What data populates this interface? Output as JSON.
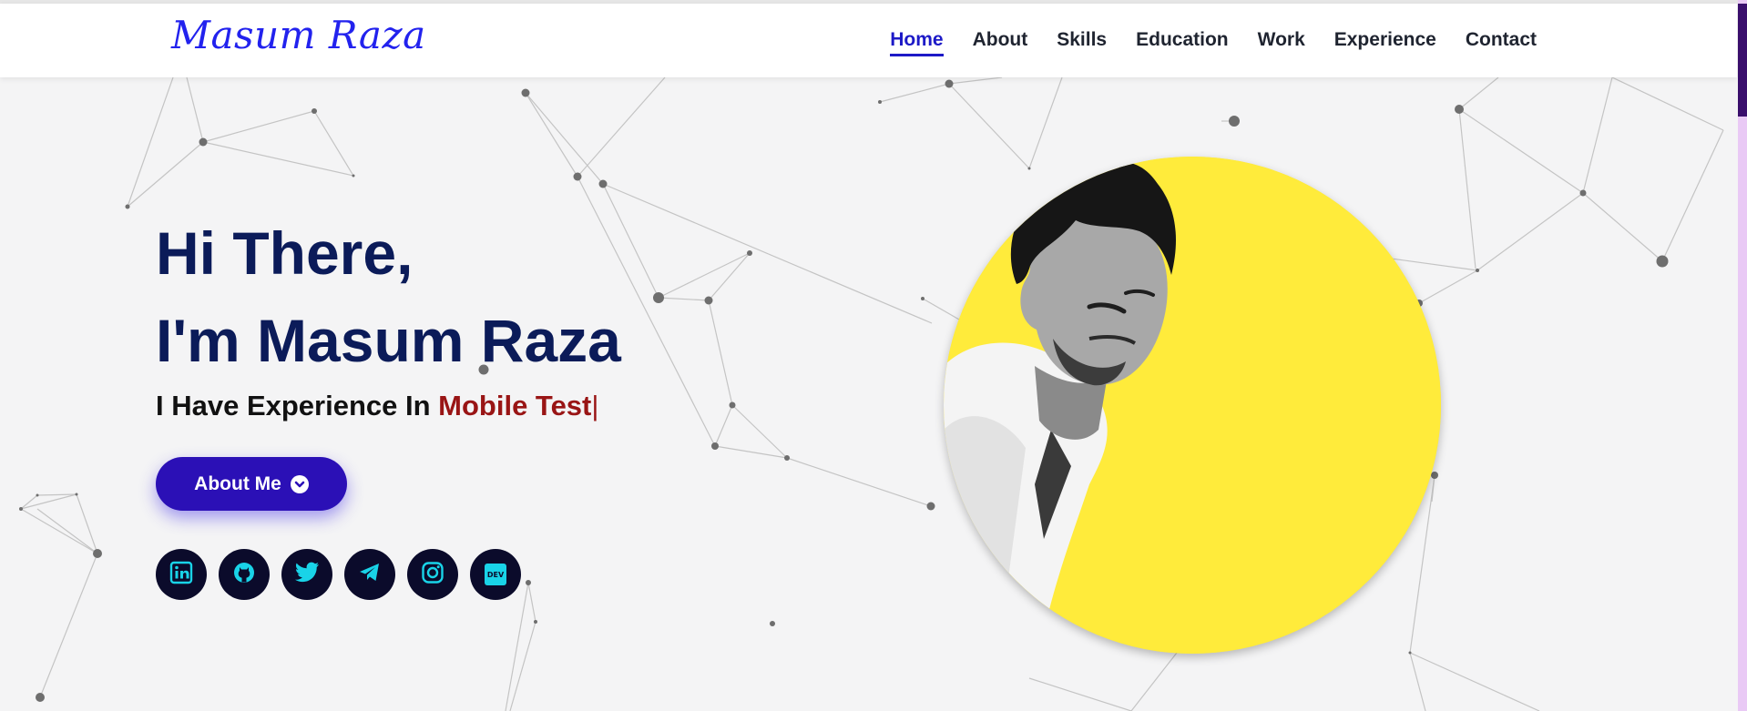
{
  "brand": {
    "logo_text": "Masum Raza"
  },
  "nav": {
    "items": [
      {
        "label": "Home",
        "active": true
      },
      {
        "label": "About"
      },
      {
        "label": "Skills"
      },
      {
        "label": "Education"
      },
      {
        "label": "Work"
      },
      {
        "label": "Experience"
      },
      {
        "label": "Contact"
      }
    ]
  },
  "hero": {
    "greeting": "Hi There,",
    "name_line": "I'm Masum Raza",
    "tagline_prefix": "I Have Experience In ",
    "typed_text": "Mobile Test",
    "caret": "|",
    "button_label": "About Me",
    "button_icon": "chevron-down-circle-icon"
  },
  "socials": [
    {
      "name": "linkedin-icon"
    },
    {
      "name": "github-icon"
    },
    {
      "name": "twitter-icon"
    },
    {
      "name": "telegram-icon"
    },
    {
      "name": "instagram-icon"
    },
    {
      "name": "dev-icon",
      "badge": "DEV"
    }
  ],
  "colors": {
    "heading": "#0b1b59",
    "accent_text": "#991515",
    "button": "#2b10b6",
    "nav_active": "#1d1ac7",
    "photo_background": "#ffeb3b",
    "social_icon": "#19d3e8"
  }
}
